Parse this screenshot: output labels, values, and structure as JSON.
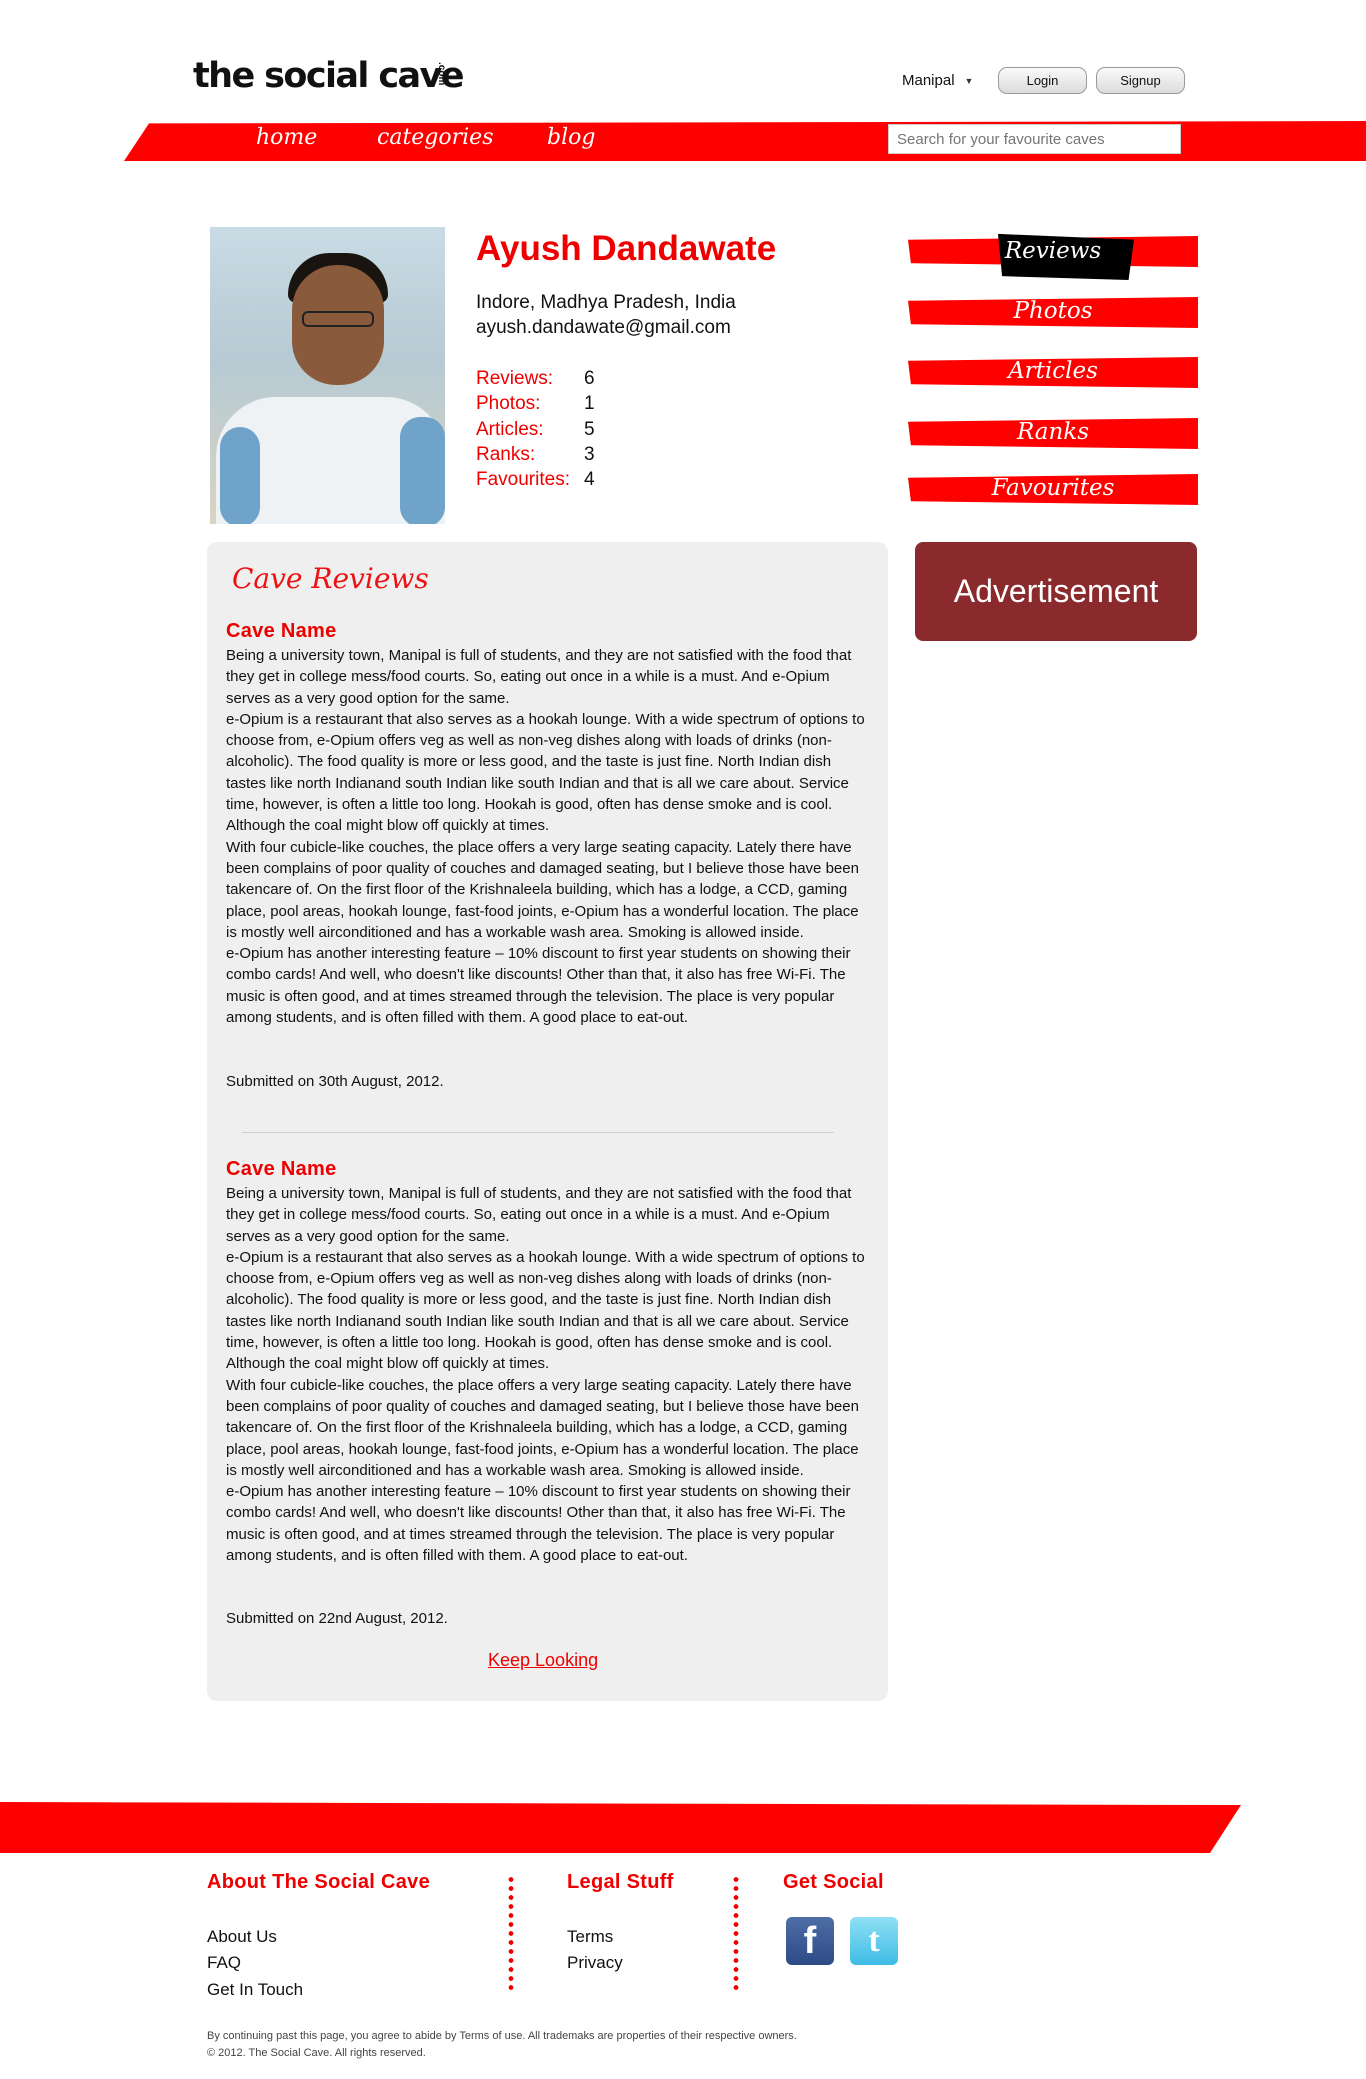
{
  "header": {
    "logo": "the social cave",
    "logo_suffix": ".com",
    "city": "Manipal",
    "login_label": "Login",
    "signup_label": "Signup"
  },
  "nav": {
    "items": [
      "home",
      "categories",
      "blog"
    ],
    "search_placeholder": "Search for your favourite caves"
  },
  "profile": {
    "name": "Ayush Dandawate",
    "location": "Indore, Madhya Pradesh, India",
    "email": "ayush.dandawate@gmail.com",
    "stats": [
      {
        "label": "Reviews:",
        "value": "6"
      },
      {
        "label": "Photos:",
        "value": "1"
      },
      {
        "label": "Articles:",
        "value": "5"
      },
      {
        "label": "Ranks:",
        "value": "3"
      },
      {
        "label": "Favourites:",
        "value": "4"
      }
    ]
  },
  "side_tabs": {
    "items": [
      "Reviews",
      "Photos",
      "Articles",
      "Ranks",
      "Favourites"
    ],
    "active": "Reviews"
  },
  "reviews": {
    "title": "Cave Reviews",
    "items": [
      {
        "cave_name": "Cave Name",
        "text": "Being a university town, Manipal is full of students, and they are not satisfied with the food that they get in college mess/food courts. So, eating out once in a while is a must. And e-Opium serves as a very good option for the same.\ne-Opium is a restaurant that also serves as a hookah lounge. With a wide spectrum of options to choose from, e-Opium offers veg as well as non-veg dishes along with loads of drinks (non-alcoholic). The food quality is more or less good, and the taste is just fine. North Indian dish tastes like north Indianand south Indian like south Indian and that is all we care about. Service time, however, is often a little too long. Hookah is good, often has dense smoke and is cool. Although the coal might blow off quickly at times.\nWith four cubicle-like couches, the place offers a very large seating capacity. Lately there have been complains of poor quality of couches and damaged seating, but I believe those have been takencare of. On the first floor of the Krishnaleela building, which has a lodge, a CCD, gaming place, pool areas, hookah lounge, fast-food joints, e-Opium has a wonderful location. The place is mostly well airconditioned and has a workable wash area. Smoking is allowed inside.\ne-Opium has another interesting feature – 10% discount to first year students on showing their combo cards! And well, who doesn't like discounts! Other than that, it also has free Wi-Fi. The music is often good, and at times streamed through the television. The place is very popular among students, and is often filled with them. A good place to eat-out.",
        "submitted": "Submitted on 30th August, 2012."
      },
      {
        "cave_name": "Cave Name",
        "text": "Being a university town, Manipal is full of students, and they are not satisfied with the food that they get in college mess/food courts. So, eating out once in a while is a must. And e-Opium serves as a very good option for the same.\ne-Opium is a restaurant that also serves as a hookah lounge. With a wide spectrum of options to choose from, e-Opium offers veg as well as non-veg dishes along with loads of drinks (non-alcoholic). The food quality is more or less good, and the taste is just fine. North Indian dish tastes like north Indianand south Indian like south Indian and that is all we care about. Service time, however, is often a little too long. Hookah is good, often has dense smoke and is cool. Although the coal might blow off quickly at times.\nWith four cubicle-like couches, the place offers a very large seating capacity. Lately there have been complains of poor quality of couches and damaged seating, but I believe those have been takencare of. On the first floor of the Krishnaleela building, which has a lodge, a CCD, gaming place, pool areas, hookah lounge, fast-food joints, e-Opium has a wonderful location. The place is mostly well airconditioned and has a workable wash area. Smoking is allowed inside.\ne-Opium has another interesting feature – 10% discount to first year students on showing their combo cards! And well, who doesn't like discounts! Other than that, it also has free Wi-Fi. The music is often good, and at times streamed through the television. The place is very popular among students, and is often filled with them. A good place to eat-out.",
        "submitted": "Submitted on 22nd August, 2012."
      }
    ],
    "keep_looking": "Keep Looking"
  },
  "ad": {
    "label": "Advertisement"
  },
  "footer": {
    "about": {
      "heading": "About The Social Cave",
      "links": [
        "About Us",
        "FAQ",
        "Get In Touch"
      ]
    },
    "legal": {
      "heading": "Legal Stuff",
      "links": [
        "Terms",
        "Privacy"
      ]
    },
    "social": {
      "heading": "Get Social",
      "icons": [
        "facebook-icon",
        "twitter-icon"
      ],
      "facebook_glyph": "f",
      "twitter_glyph": "t"
    },
    "disclaimer": "By continuing past this page, you agree to abide by Terms of use. All trademaks are properties of their respective owners.",
    "copyright": "© 2012. The Social Cave. All rights reserved."
  },
  "colors": {
    "accent": "#ee0000",
    "nav_red": "#ff0000",
    "panel_bg": "#efefef",
    "ad_bg": "#8b2a2c"
  }
}
